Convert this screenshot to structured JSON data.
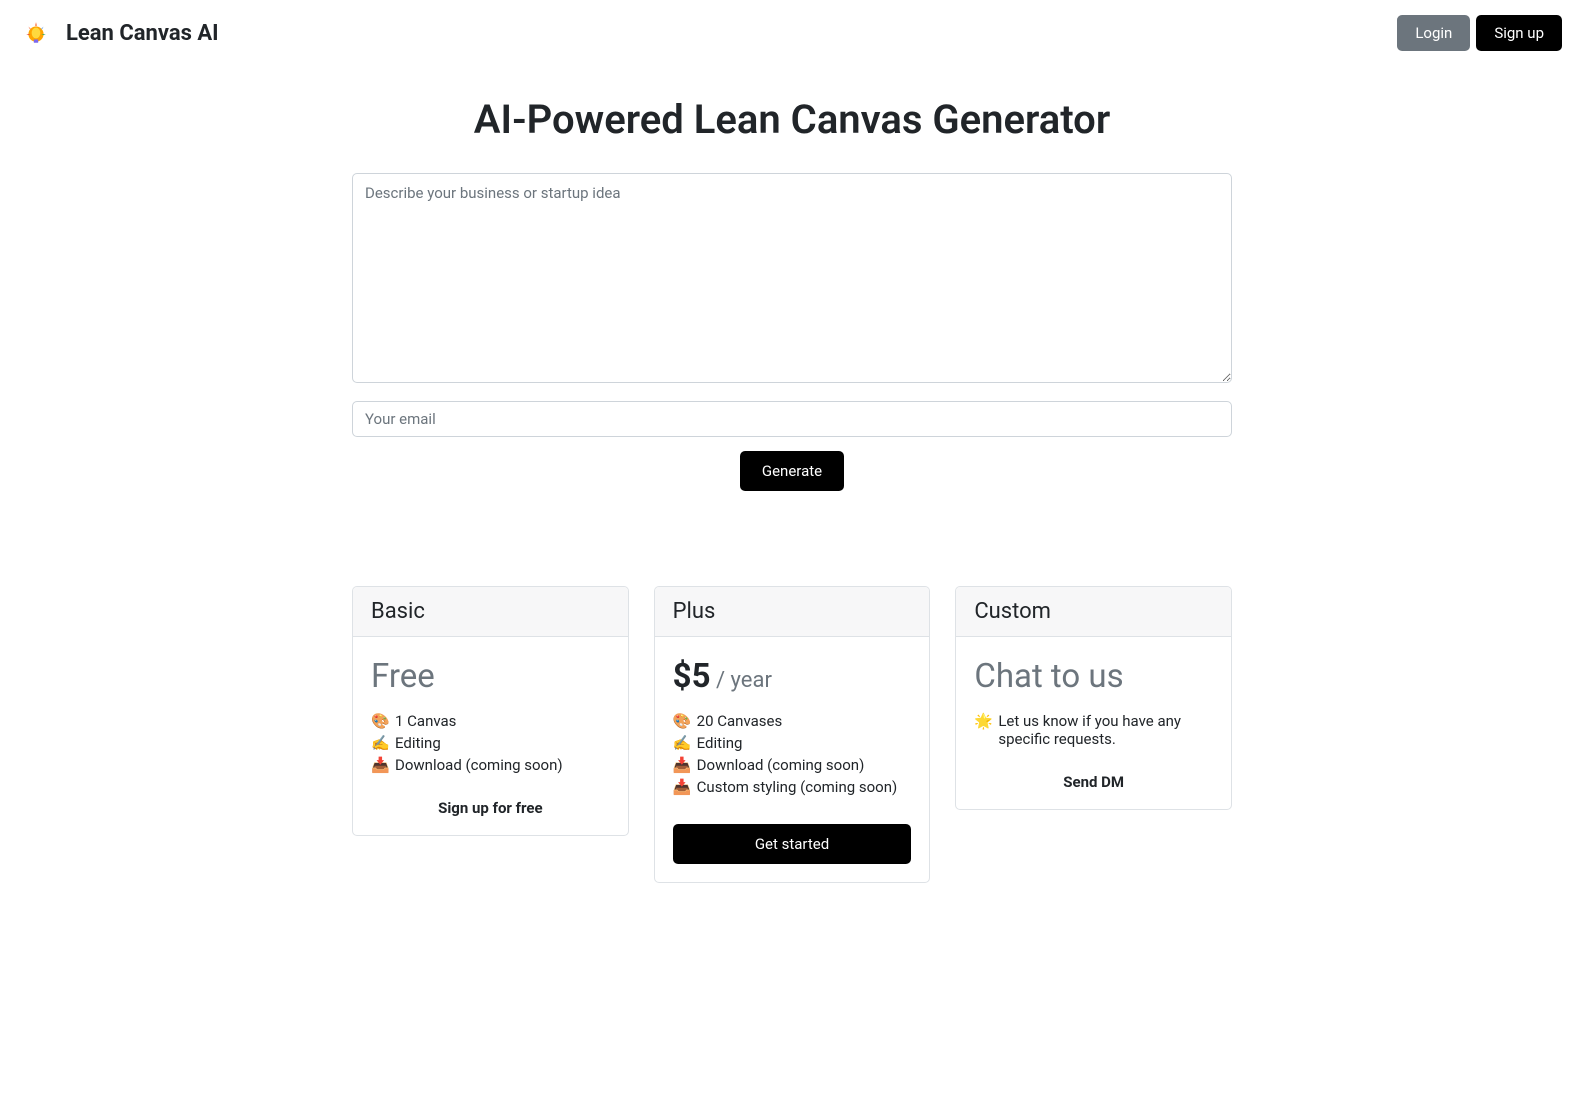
{
  "header": {
    "brand": "Lean Canvas AI",
    "login_label": "Login",
    "signup_label": "Sign up"
  },
  "main": {
    "title": "AI-Powered Lean Canvas Generator",
    "idea_placeholder": "Describe your business or startup idea",
    "email_placeholder": "Your email",
    "generate_label": "Generate"
  },
  "pricing": {
    "basic": {
      "title": "Basic",
      "price": "Free",
      "features": [
        {
          "icon": "🎨",
          "text": "1 Canvas"
        },
        {
          "icon": "✍️",
          "text": "Editing"
        },
        {
          "icon": "📥",
          "text": "Download (coming soon)"
        }
      ],
      "cta": "Sign up for free"
    },
    "plus": {
      "title": "Plus",
      "price_amount": "$5",
      "price_period": " / year",
      "features": [
        {
          "icon": "🎨",
          "text": "20 Canvases"
        },
        {
          "icon": "✍️",
          "text": "Editing"
        },
        {
          "icon": "📥",
          "text": "Download (coming soon)"
        },
        {
          "icon": "📥",
          "text": "Custom styling (coming soon)"
        }
      ],
      "cta": "Get started"
    },
    "custom": {
      "title": "Custom",
      "price": "Chat to us",
      "description_icon": "🌟",
      "description": "Let us know if you have any specific requests.",
      "cta": "Send DM"
    }
  }
}
